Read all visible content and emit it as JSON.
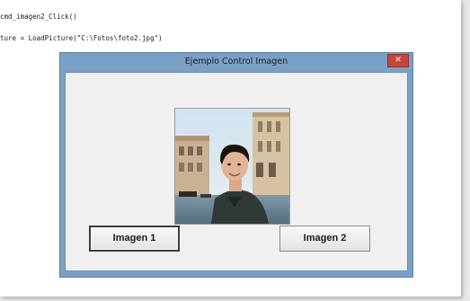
{
  "editor": {
    "line1": "cmd_imagen2_Click()",
    "line2": "ture = LoadPicture(\"C:\\Fotos\\foto2.jpg\")"
  },
  "window": {
    "title": "Ejemplo Control Imagen",
    "close_label": "✕"
  },
  "buttons": {
    "imagen1": "Imagen 1",
    "imagen2": "Imagen 2"
  },
  "photo": {
    "alt": "photo-man-venice"
  }
}
